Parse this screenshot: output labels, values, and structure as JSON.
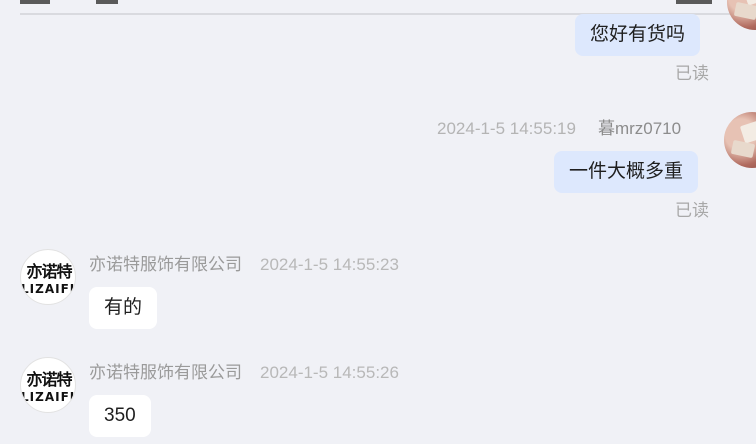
{
  "messages": [
    {
      "direction": "out",
      "text": "您好有货吗",
      "status": "已读"
    },
    {
      "direction": "out",
      "sender": "暮mrz0710",
      "time": "2024-1-5 14:55:19",
      "text": "一件大概多重",
      "status": "已读"
    },
    {
      "direction": "in",
      "sender": "亦诺特服饰有限公司",
      "time": "2024-1-5 14:55:23",
      "text": "有的"
    },
    {
      "direction": "in",
      "sender": "亦诺特服饰有限公司",
      "time": "2024-1-5 14:55:26",
      "text": "350"
    }
  ],
  "shop_logo": {
    "cn": "亦诺特",
    "en": "LIZAIFI"
  }
}
